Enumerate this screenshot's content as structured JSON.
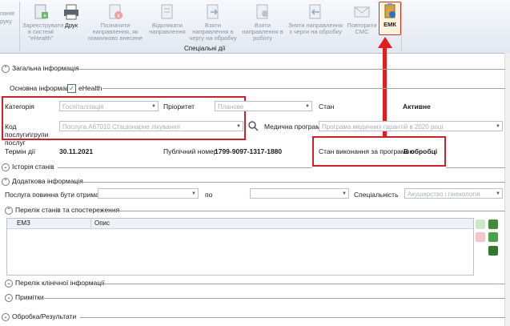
{
  "ribbon": {
    "left_cut_1": "панів",
    "left_cut_2": "руку",
    "buttons": [
      {
        "label": "Зареєструвати в системі \"eHealth\""
      },
      {
        "label": "Друк"
      },
      {
        "label": "Позначити направлення, як помилково внесене"
      },
      {
        "label": "Відкликати направлення"
      },
      {
        "label": "Взяти направлення в чергу на обробку"
      },
      {
        "label": "Взяти направлення в роботу"
      },
      {
        "label": "Зняти направлення з черги на обробку"
      },
      {
        "label": "Повторити СМС"
      },
      {
        "label": "ЕМК"
      }
    ],
    "group_label": "Спеціальні дії"
  },
  "sections": {
    "general": "Загальна інформація",
    "main_info": "Основна інформація",
    "ehealth": "eHealth",
    "history": "Історія станів",
    "additional": "Додаткова інформація",
    "states_list": "Перелік станів та спостереження",
    "clinical": "Перелік клінічної інформації",
    "notes": "Примітки",
    "processing": "Обробка/Результати"
  },
  "form": {
    "category_label": "Категорія",
    "category_value": "Госпіталізація",
    "priority_label": "Пріоритет",
    "priority_value": "Планове",
    "state_label": "Стан",
    "state_value": "Активне",
    "service_code_label": "Код послуги\\групи послуг",
    "service_code_value": "Послуга A67010 Стаціонарне лікування",
    "med_program_label": "Медична програма",
    "med_program_value": "Програма медичних гарантій в 2020 році",
    "term_label": "Термін дії",
    "term_value": "30.11.2021",
    "public_number_label": "Публічний номер",
    "public_number_value": "1799-9097-1317-1880",
    "program_state_label": "Стан виконання за програмою",
    "program_state_value": "В обробці",
    "service_received_label": "Послуга повинна бути отримана з",
    "to_label": "по",
    "specialty_label": "Спеціальність",
    "specialty_value": "Акушерство і гінекологія"
  },
  "grid": {
    "col_emz": "ЕМЗ",
    "col_description": "Опис"
  },
  "colors": {
    "highlight": "#d0202a",
    "ribbon_bg": "#e2e8f1"
  }
}
